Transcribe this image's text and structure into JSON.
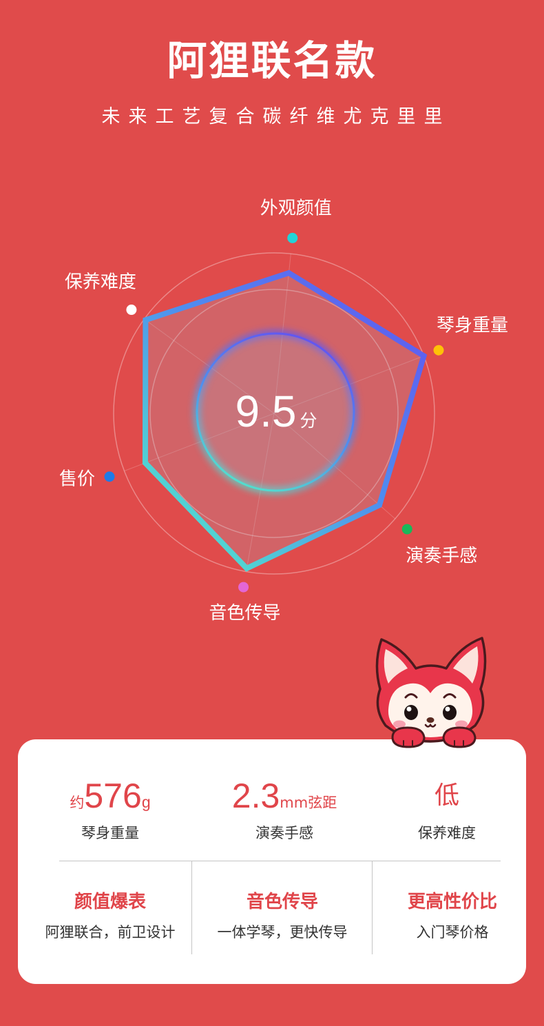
{
  "header": {
    "title": "阿狸联名款",
    "subtitle": "未来工艺复合碳纤维尤克里里"
  },
  "theme": {
    "background": "#E04B4B",
    "accent": "#E0454A"
  },
  "chart_data": {
    "type": "radar",
    "axes": [
      "外观颜值",
      "琴身重量",
      "演奏手感",
      "音色传导",
      "售价",
      "保养难度"
    ],
    "axis_colors": [
      "#22D3D8",
      "#FFC107",
      "#19B85A",
      "#E466D6",
      "#1E7BE8",
      "#FFFFFF"
    ],
    "series": [
      {
        "values": [
          0.88,
          1.0,
          0.87,
          0.98,
          0.86,
          0.99
        ]
      }
    ],
    "series_colors": [
      "#6352F0",
      "#4F8DEF",
      "#52E6CB"
    ],
    "grid": true,
    "score": {
      "value": "9.5",
      "unit": "分"
    }
  },
  "stats": {
    "weight": {
      "prefix": "约",
      "value": "576",
      "unit": "g",
      "label": "琴身重量"
    },
    "action": {
      "value": "2.3",
      "unit": "mm弦距",
      "label": "演奏手感"
    },
    "care": {
      "value": "低",
      "label": "保养难度"
    },
    "features": [
      {
        "title": "颜值爆表",
        "desc": "阿狸联合，前卫设计"
      },
      {
        "title": "音色传导",
        "desc": "一体学琴，更快传导"
      },
      {
        "title": "更高性价比",
        "desc": "入门琴价格"
      }
    ]
  }
}
